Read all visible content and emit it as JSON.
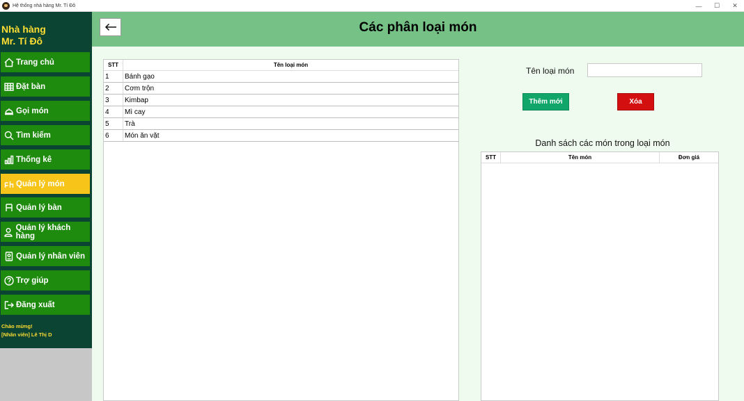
{
  "window": {
    "title": "Hệ thống nhà hàng Mr. Tí Đô",
    "controls": [
      "—",
      "☐",
      "✕"
    ]
  },
  "sidebar": {
    "brand_line1": "Nhà hàng",
    "brand_line2": "Mr. Tí Đô",
    "items": [
      {
        "label": "Trang chủ",
        "icon": "home-icon"
      },
      {
        "label": "Đặt bàn",
        "icon": "table-grid-icon"
      },
      {
        "label": "Gọi món",
        "icon": "dish-cover-icon"
      },
      {
        "label": "Tìm kiếm",
        "icon": "search-icon"
      },
      {
        "label": "Thống kê",
        "icon": "chart-icon"
      },
      {
        "label": "Quản lý món",
        "icon": "menu-manage-icon",
        "active": true
      },
      {
        "label": "Quản lý bàn",
        "icon": "chair-icon"
      },
      {
        "label": "Quản lý khách hàng",
        "icon": "user-icon"
      },
      {
        "label": "Quản lý nhân viên",
        "icon": "id-badge-icon"
      },
      {
        "label": "Trợ giúp",
        "icon": "help-icon"
      },
      {
        "label": "Đăng xuất",
        "icon": "logout-icon"
      }
    ],
    "greeting": "Chào mừng!",
    "user": "[Nhân viên] Lê Thị D",
    "active_color": "#f7c51a",
    "item_color": "#1e8a0e"
  },
  "header": {
    "title": "Các phân loại món",
    "back_icon": "arrow-left-icon"
  },
  "categories": {
    "headers": [
      "STT",
      "Tên loại món"
    ],
    "rows": [
      [
        "1",
        "Bánh gạo"
      ],
      [
        "2",
        "Cơm trộn"
      ],
      [
        "3",
        "Kimbap"
      ],
      [
        "4",
        "Mì cay"
      ],
      [
        "5",
        "Trà"
      ],
      [
        "6",
        "Món ăn vặt"
      ]
    ]
  },
  "form": {
    "name_label": "Tên loại món",
    "name_value": "",
    "add_label": "Thêm mới",
    "delete_label": "Xóa"
  },
  "dishes": {
    "caption": "Danh sách các món trong loại món",
    "headers": [
      "STT",
      "Tên món",
      "Đơn giá"
    ],
    "rows": []
  }
}
